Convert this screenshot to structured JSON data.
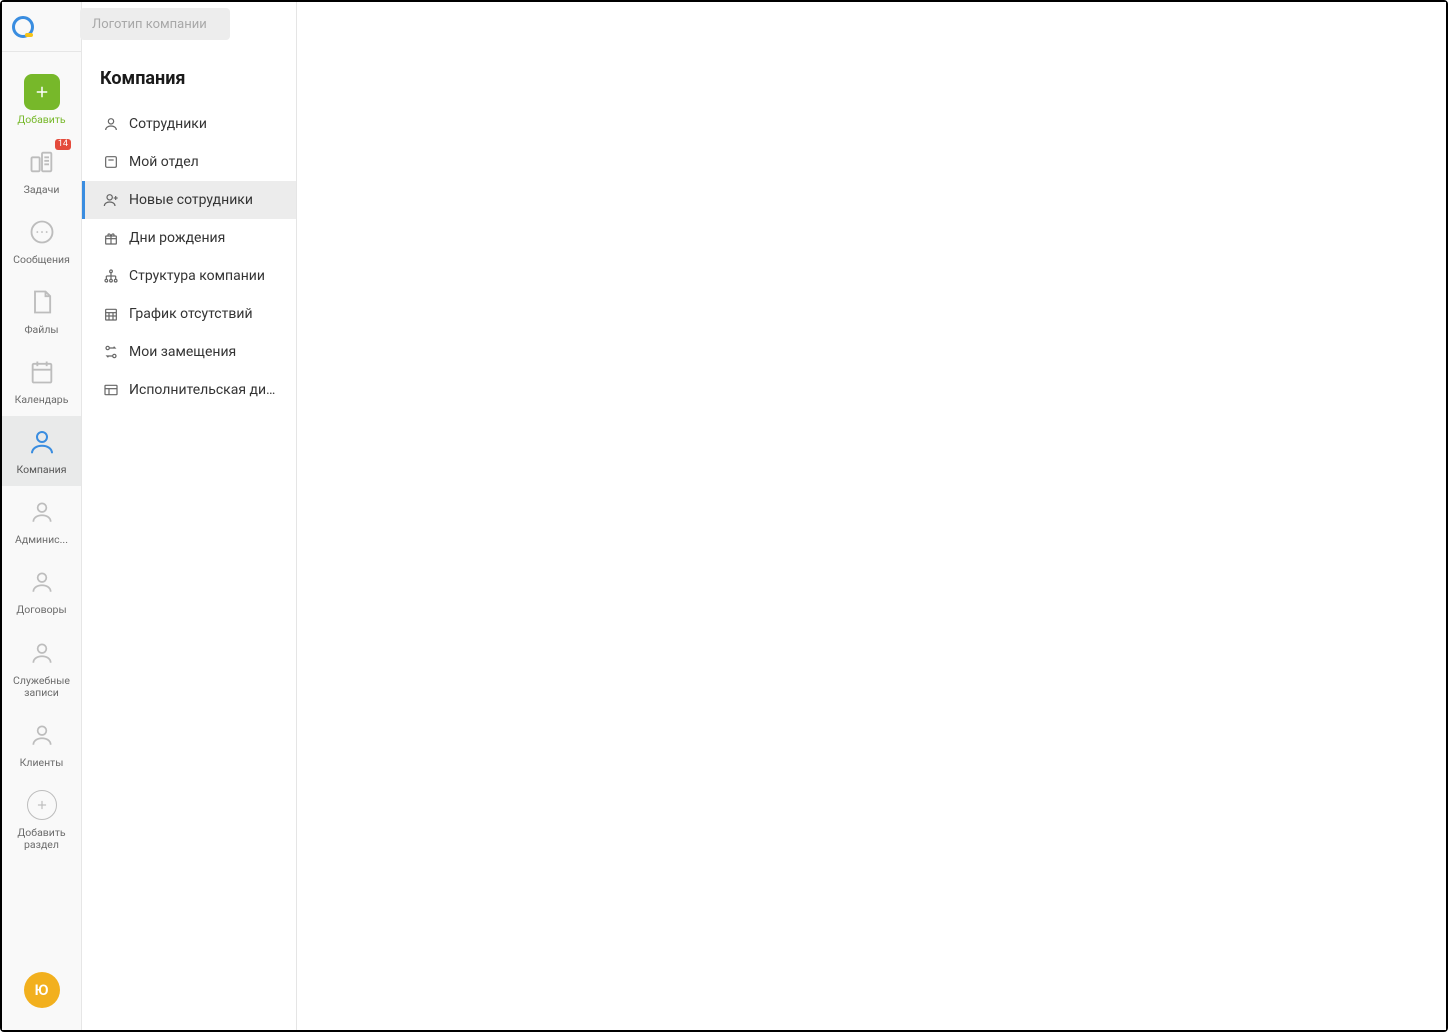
{
  "header": {
    "logo_placeholder": "Логотип компании"
  },
  "nav": {
    "add": {
      "label": "Добавить"
    },
    "tasks": {
      "label": "Задачи",
      "badge": "14"
    },
    "messages": {
      "label": "Сообщения"
    },
    "files": {
      "label": "Файлы"
    },
    "calendar": {
      "label": "Календарь"
    },
    "company": {
      "label": "Компания"
    },
    "admin": {
      "label": "Админис..."
    },
    "contracts": {
      "label": "Договоры"
    },
    "memos": {
      "label": "Служебные записи"
    },
    "clients": {
      "label": "Клиенты"
    },
    "add_section": {
      "label": "Добавить раздел"
    }
  },
  "avatar": {
    "initial": "Ю"
  },
  "subpanel": {
    "title": "Компания",
    "items": [
      {
        "label": "Сотрудники"
      },
      {
        "label": "Мой отдел"
      },
      {
        "label": "Новые сотрудники"
      },
      {
        "label": "Дни рождения"
      },
      {
        "label": "Структура компании"
      },
      {
        "label": "График отсутствий"
      },
      {
        "label": "Мои замещения"
      },
      {
        "label": "Исполнительская дисц..."
      }
    ],
    "active_index": 2
  }
}
